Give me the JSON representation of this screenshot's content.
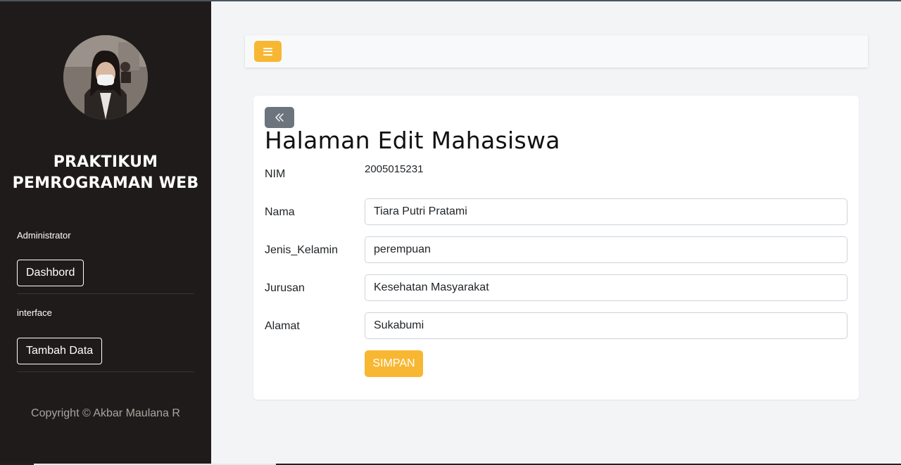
{
  "sidebar": {
    "brand_line1": "PRAKTIKUM",
    "brand_line2": "PEMROGRAMAN WEB",
    "sections": [
      {
        "label": "Administrator",
        "button": "Dashbord"
      },
      {
        "label": "interface",
        "button": "Tambah Data"
      }
    ],
    "copyright": "Copyright © Akbar Maulana R"
  },
  "form": {
    "title": "Halaman Edit Mahasiswa",
    "nim_label": "NIM",
    "nim_value": "2005015231",
    "fields": [
      {
        "label": "Nama",
        "value": "Tiara Putri Pratami"
      },
      {
        "label": "Jenis_Kelamin",
        "value": "perempuan"
      },
      {
        "label": "Jurusan",
        "value": "Kesehatan Masyarakat"
      },
      {
        "label": "Alamat",
        "value": "Sukabumi"
      }
    ],
    "submit_label": "SIMPAN"
  },
  "colors": {
    "accent": "#f8b733",
    "sidebar_bg": "#1f1b1a",
    "back_button": "#6c757d"
  },
  "icons": {
    "menu": "hamburger-icon",
    "back": "double-chevron-left-icon"
  }
}
